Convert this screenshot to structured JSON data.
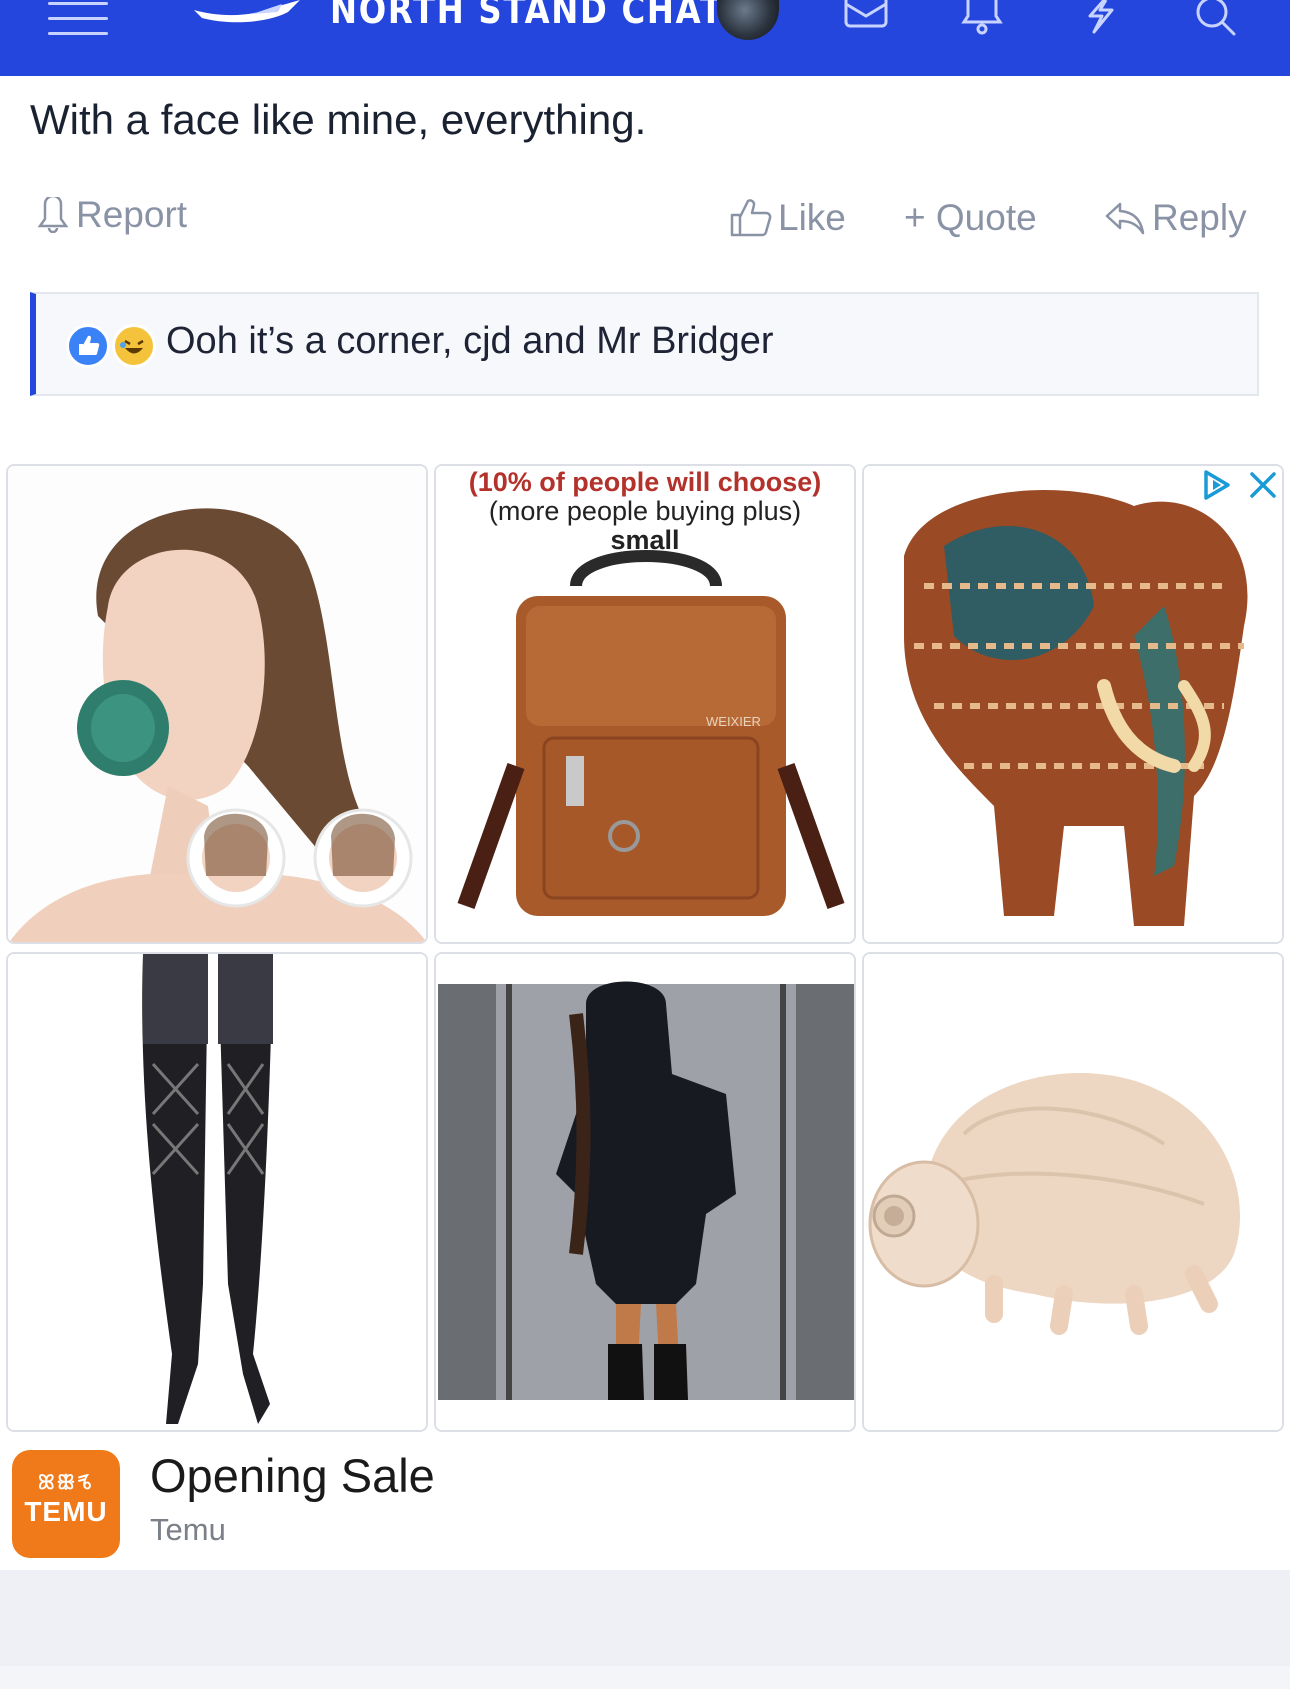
{
  "header": {
    "site_name": "NORTH STAND CHAT",
    "icons": [
      "menu-icon",
      "logo-bird-icon",
      "avatar",
      "mail-icon",
      "bell-icon",
      "lightning-icon",
      "search-icon"
    ]
  },
  "post": {
    "text": "With a face like mine, everything.",
    "actions": {
      "report": "Report",
      "like": "Like",
      "quote": "+ Quote",
      "reply": "Reply"
    },
    "reactions": {
      "text": "Ooh it’s a corner, cjd and Mr Bridger",
      "icons": [
        "like-reaction-icon",
        "laugh-reaction-icon"
      ]
    }
  },
  "ad": {
    "products": [
      {
        "name": "face-slimmer-product"
      },
      {
        "name": "leather-bag-product",
        "caption_red": "(10% of people will choose)",
        "caption_2": "(more people buying plus)",
        "caption_3": "small",
        "brand_mark": "WEIXIER"
      },
      {
        "name": "elephant-puzzle-product"
      },
      {
        "name": "stockings-product"
      },
      {
        "name": "bodysuit-product"
      },
      {
        "name": "plush-toy-product"
      }
    ],
    "brand": {
      "glyphs": "ꕤꕥꕦ",
      "word": "TEMU"
    },
    "title": "Opening Sale",
    "advertiser": "Temu"
  },
  "colors": {
    "header_bg": "#2446dc",
    "accent": "#2446dc",
    "action_gray": "#8a93a6",
    "temu_orange": "#f07a1a"
  }
}
